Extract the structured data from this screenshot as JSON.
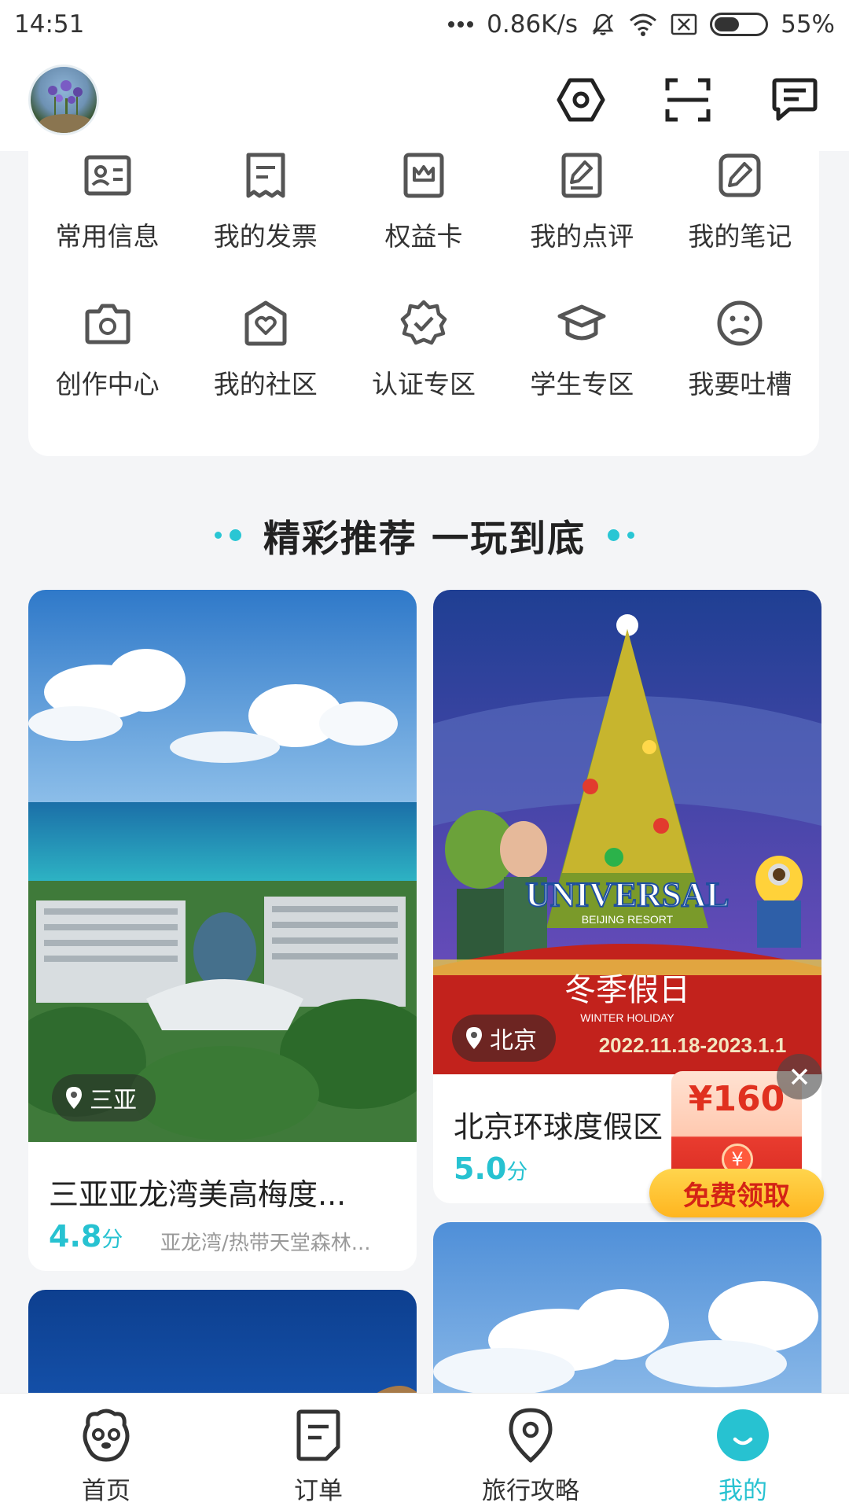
{
  "status_bar": {
    "time": "14:51",
    "network_speed": "0.86K/s",
    "battery_percent_text": "55%",
    "battery_level": 0.55
  },
  "header": {
    "avatar_icon": "user-avatar",
    "actions": [
      "settings-icon",
      "scan-icon",
      "message-icon"
    ]
  },
  "menu": {
    "items": [
      {
        "label": "常用信息",
        "icon": "contact-card-icon"
      },
      {
        "label": "我的发票",
        "icon": "invoice-icon"
      },
      {
        "label": "权益卡",
        "icon": "benefit-card-icon"
      },
      {
        "label": "我的点评",
        "icon": "review-icon"
      },
      {
        "label": "我的笔记",
        "icon": "note-icon"
      },
      {
        "label": "创作中心",
        "icon": "camera-icon"
      },
      {
        "label": "我的社区",
        "icon": "community-icon"
      },
      {
        "label": "认证专区",
        "icon": "verified-icon"
      },
      {
        "label": "学生专区",
        "icon": "graduation-cap-icon"
      },
      {
        "label": "我要吐槽",
        "icon": "sad-face-icon"
      }
    ]
  },
  "section": {
    "title": "精彩推荐 一玩到底"
  },
  "cards": [
    {
      "location": "三亚",
      "title": "三亚亚龙湾美高梅度...",
      "score": "4.8",
      "score_unit": "分",
      "subtitle": "亚龙湾/热带天堂森林..."
    },
    {
      "location": "北京",
      "title": "北京环球度假区",
      "score": "5.0",
      "score_unit": "分",
      "image_text_brand": "UNIVERSAL",
      "image_text_resort": "BEIJING RESORT",
      "image_text_event": "冬季假日",
      "image_text_event_en": "WINTER HOLIDAY",
      "image_text_dates": "2022.11.18-2023.1.1"
    }
  ],
  "coupon": {
    "amount": "¥160",
    "yen": "¥",
    "button_label": "免费领取"
  },
  "tab_bar": {
    "tabs": [
      {
        "label": "首页",
        "icon": "home-mascot-icon"
      },
      {
        "label": "订单",
        "icon": "order-icon"
      },
      {
        "label": "旅行攻略",
        "icon": "location-pin-icon"
      },
      {
        "label": "我的",
        "icon": "smile-profile-icon",
        "active": true
      }
    ]
  },
  "colors": {
    "accent": "#27c2d1",
    "background": "#f4f5f7",
    "coupon_red": "#e0301f"
  }
}
